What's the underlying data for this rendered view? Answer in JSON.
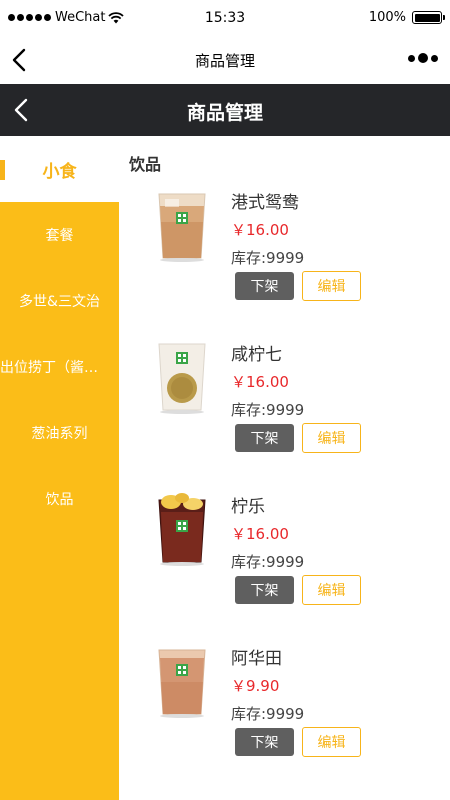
{
  "status_bar": {
    "carrier": "WeChat",
    "time": "15:33",
    "battery": "100%"
  },
  "wechat_nav": {
    "title": "商品管理"
  },
  "header": {
    "title": "商品管理"
  },
  "sidebar": {
    "items": [
      {
        "label": "小食",
        "active": true
      },
      {
        "label": "套餐",
        "active": false
      },
      {
        "label": "多世&三文治",
        "active": false
      },
      {
        "label": "出位捞丁（酱…",
        "active": false
      },
      {
        "label": "葱油系列",
        "active": false
      },
      {
        "label": "饮品",
        "active": false
      }
    ]
  },
  "content": {
    "section_title": "饮品",
    "products": [
      {
        "name": "港式鸳鸯",
        "price": "￥16.00",
        "stock": "库存:9999",
        "off_label": "下架",
        "edit_label": "编辑",
        "icon": "milk-tea-drink"
      },
      {
        "name": "咸柠七",
        "price": "￥16.00",
        "stock": "库存:9999",
        "off_label": "下架",
        "edit_label": "编辑",
        "icon": "lemon-soda-drink"
      },
      {
        "name": "柠乐",
        "price": "￥16.00",
        "stock": "库存:9999",
        "off_label": "下架",
        "edit_label": "编辑",
        "icon": "lemon-cola-drink"
      },
      {
        "name": "阿华田",
        "price": "￥9.90",
        "stock": "库存:9999",
        "off_label": "下架",
        "edit_label": "编辑",
        "icon": "ovaltine-drink"
      }
    ]
  },
  "colors": {
    "accent_yellow": "#FBBD18",
    "header_dark": "#252629",
    "price_red": "#E8282B",
    "off_button": "#5F5F5F"
  }
}
